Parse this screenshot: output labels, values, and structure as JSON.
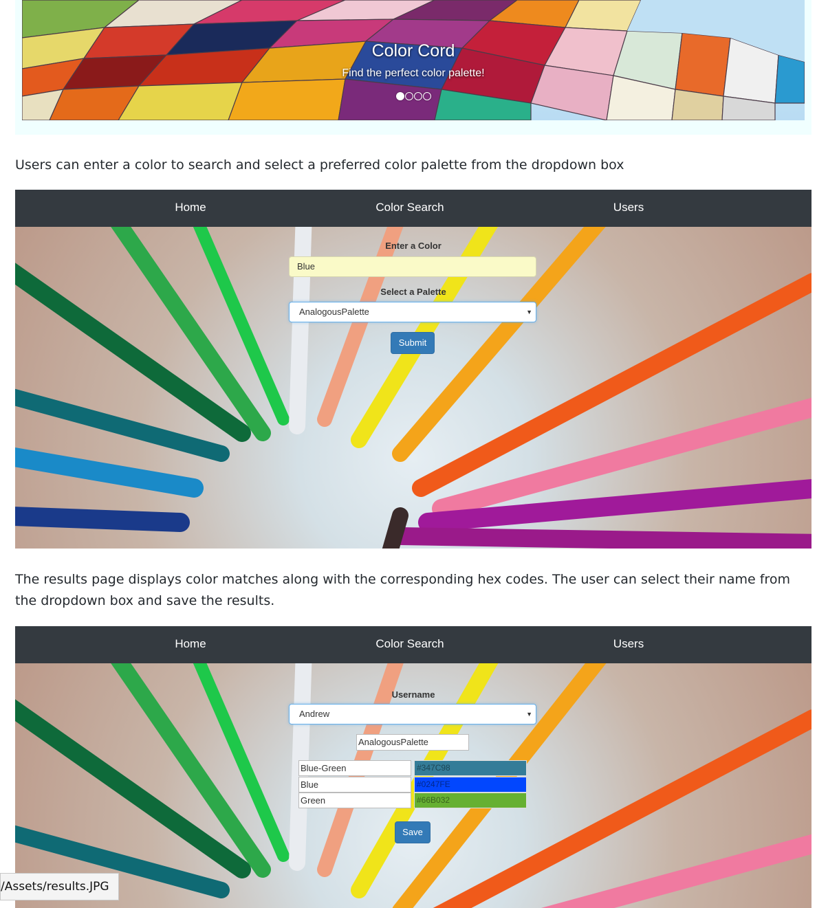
{
  "hero": {
    "title": "Color Cord",
    "subtitle": "Find the perfect color palette!",
    "slide_count": 4,
    "active_slide": 1
  },
  "descriptions": {
    "search": "Users can enter a color to search and select a preferred color palette from the dropdown box",
    "results": "The results page displays color matches along with the corresponding hex codes. The user can select their name from the dropdown box and save the results."
  },
  "nav": {
    "home": "Home",
    "color_search": "Color Search",
    "users": "Users"
  },
  "search_form": {
    "color_label": "Enter a Color",
    "color_value": "Blue",
    "palette_label": "Select a Palette",
    "palette_selected": "AnalogousPalette",
    "submit_label": "Submit"
  },
  "results_form": {
    "username_label": "Username",
    "username_selected": "Andrew",
    "palette_name": "AnalogousPalette",
    "matches": [
      {
        "name": "Blue-Green",
        "hex": "#347C98",
        "color": "#347C98"
      },
      {
        "name": "Blue",
        "hex": "#0247FE",
        "color": "#0247FE"
      },
      {
        "name": "Green",
        "hex": "#66B032",
        "color": "#66B032"
      }
    ],
    "save_label": "Save"
  },
  "status_bar": {
    "url_text": "/Assets/results.JPG"
  }
}
